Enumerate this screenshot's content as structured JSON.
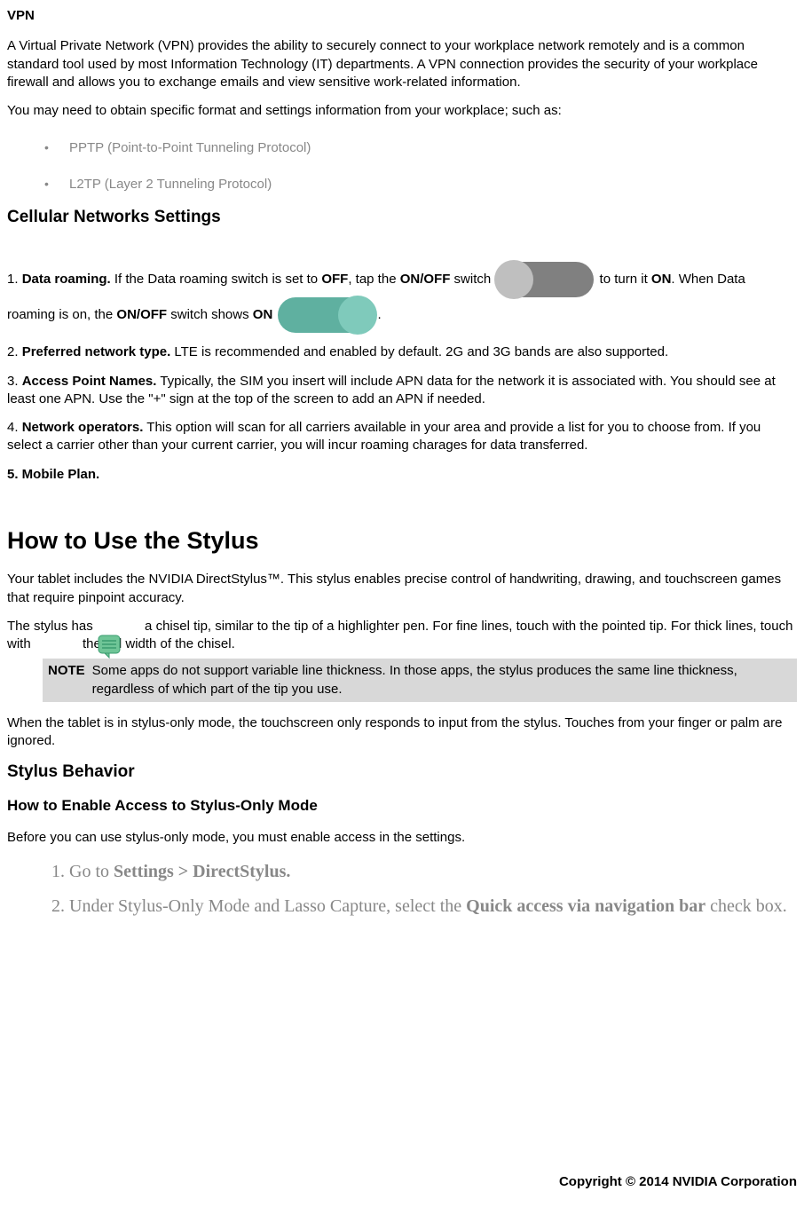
{
  "vpn": {
    "title": "VPN",
    "p1": "A Virtual Private Network (VPN) provides the ability to securely connect to your workplace network remotely and is a common standard tool used by most Information Technology (IT) departments.  A VPN connection provides the security of your workplace firewall and allows you to exchange emails and view sensitive work-related information.",
    "p2": "You may need to obtain specific format and settings information from your workplace; such as:",
    "bullets": [
      "PPTP (Point-to-Point Tunneling Protocol)",
      "L2TP (Layer 2 Tunneling Protocol)"
    ]
  },
  "cellular": {
    "title": "Cellular Networks Settings",
    "item1_a": "1. ",
    "item1_b": "Data roaming.",
    "item1_c": " If the Data roaming switch is set to ",
    "item1_d": "OFF",
    "item1_e": ", tap the ",
    "item1_f": "ON/OFF",
    "item1_g": " switch ",
    "item1_h": " to turn it ",
    "item1_i": "ON",
    "item1_j": ".  When Data roaming is on, the ",
    "item1_k": "ON/OFF",
    "item1_l": " switch shows ",
    "item1_m": "ON",
    "item1_n": " ",
    "item1_o": ".",
    "item2_a": "2. ",
    "item2_b": "Preferred network type.",
    "item2_c": "  LTE is recommended and enabled by default.  2G and 3G bands are also supported.",
    "item3_a": "3. ",
    "item3_b": "Access Point Names.",
    "item3_c": "  Typically, the SIM you insert will include APN data for the network it is associated with.  You should see at least one APN.  Use the \"+\" sign at the top of the screen to add an APN if needed.",
    "item4_a": "4. ",
    "item4_b": "Network operators.",
    "item4_c": "  This option will scan for all carriers available in your area and provide a list for you to choose from.  If you select a carrier other than your current carrier, you will incur roaming charages for data transferred.",
    "item5": "5. Mobile Plan."
  },
  "stylus": {
    "title": "How to Use the Stylus",
    "p1": "Your tablet includes the NVIDIA DirectStylus™. This stylus enables precise control of handwriting, drawing, and touchscreen games that require pinpoint accuracy.",
    "p2_a": "The stylus has ",
    "p2_b": " a chisel tip, similar to the tip of a highlighter pen. For fine lines, touch with the pointed tip. For thick lines, touch with ",
    "p2_c": " the full width of the chisel.",
    "note_label": "NOTE",
    "note_text": "Some apps do not support variable line thickness. In those apps, the stylus produces the same line thickness, regardless of which part of the tip you use.",
    "p3": "When the tablet is in stylus-only mode, the touchscreen only responds to input from the stylus. Touches from your finger or palm are ignored."
  },
  "behavior": {
    "title": "Stylus Behavior",
    "sub": "How to Enable Access to Stylus-Only Mode",
    "intro": "Before you can use stylus-only mode, you must enable access in the settings.",
    "step1_a": "Go to ",
    "step1_b": "Settings > DirectStylus.",
    "step2_a": "Under Stylus-Only Mode and Lasso Capture, select the ",
    "step2_b": "Quick access via navigation bar",
    "step2_c": " check box."
  },
  "footer": "Copyright © 2014 NVIDIA Corporation"
}
